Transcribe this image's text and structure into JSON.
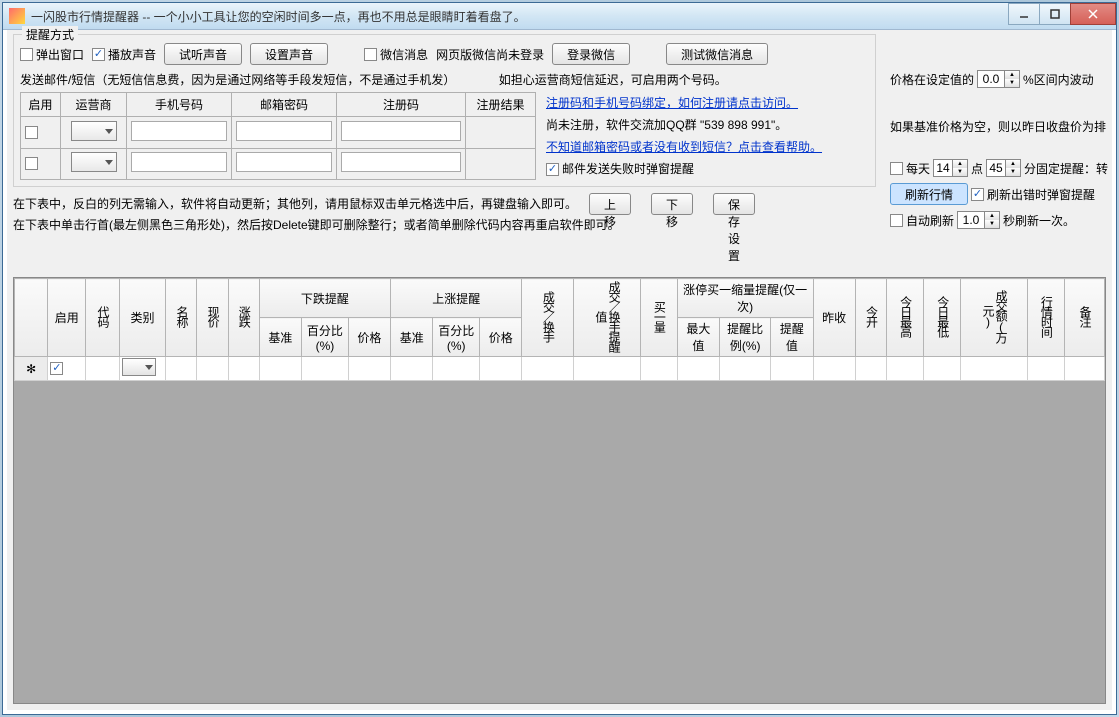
{
  "window": {
    "title": "一闪股市行情提醒器 -- 一个小小工具让您的空闲时间多一点，再也不用总是眼睛盯着看盘了。"
  },
  "reminder_section": {
    "legend": "提醒方式",
    "popup_window": "弹出窗口",
    "play_sound": "播放声音",
    "btn_test_sound": "试听声音",
    "btn_set_sound": "设置声音",
    "wechat_msg": "微信消息",
    "wechat_not_logged": "网页版微信尚未登录",
    "btn_login_wechat": "登录微信",
    "btn_test_wechat": "测试微信消息",
    "sms_note": "发送邮件/短信（无短信信息费，因为是通过网络等手段发短信，不是通过手机发）",
    "carrier_note": "如担心运营商短信延迟，可启用两个号码。"
  },
  "mail_table": {
    "h_enable": "启用",
    "h_carrier": "运营商",
    "h_phone": "手机号码",
    "h_mailpwd": "邮箱密码",
    "h_regcode": "注册码",
    "h_regresult": "注册结果"
  },
  "mail_right": {
    "link1": "注册码和手机号码绑定，如何注册请点击访问。",
    "text1a": "尚未注册，软件交流加QQ群 ",
    "qq": "\"539 898 991\"",
    "text1b": "。",
    "link2": "不知道邮箱密码或者没有收到短信？点击查看帮助。",
    "cb_fail_popup": "邮件发送失败时弹窗提醒"
  },
  "instructions": {
    "line1": "在下表中，反白的列无需输入，软件将自动更新；其他列，请用鼠标双击单元格选中后，再键盘输入即可。",
    "line2": "在下表中单击行首(最左侧黑色三角形处)，然后按Delete键即可删除整行；或者简单删除代码内容再重启软件即可。",
    "btn_up": "上移",
    "btn_down": "下移",
    "btn_save": "保存设置"
  },
  "right_panel": {
    "price_at_set": "价格在设定值的",
    "price_val": "0.0",
    "range_pct": "%区间内波动",
    "baseline_note": "如果基准价格为空，则以昨日收盘价为排",
    "every_day": "每天",
    "hour_val": "14",
    "dian": "点",
    "min_val": "45",
    "fixed_remind": "分固定提醒：转",
    "btn_refresh": "刷新行情",
    "cb_refresh_err": "刷新出错时弹窗提醒",
    "cb_auto_refresh": "自动刷新",
    "auto_val": "1.0",
    "sec_refresh": "秒刷新一次。"
  },
  "grid": {
    "h_enable": "启用",
    "h_code": "代码",
    "h_type": "类别",
    "h_name": "名称",
    "h_price": "现价",
    "h_change": "涨跌",
    "h_fall": "下跌提醒",
    "h_rise": "上涨提醒",
    "h_base": "基准",
    "h_pct": "百分比(%)",
    "h_priceval": "价格",
    "h_volhand": "成交／换手",
    "h_volhandval": "成交／换手提醒值",
    "h_buy1": "买一量",
    "h_limit": "涨停买一缩量提醒(仅一次)",
    "h_max": "最大值",
    "h_pctratio": "提醒比例(%)",
    "h_remindval": "提醒值",
    "h_prevclose": "昨收",
    "h_open": "今开",
    "h_high": "今日最高",
    "h_low": "今日最低",
    "h_amount": "成交额(万元)",
    "h_time": "行情时间",
    "h_note": "备注"
  }
}
